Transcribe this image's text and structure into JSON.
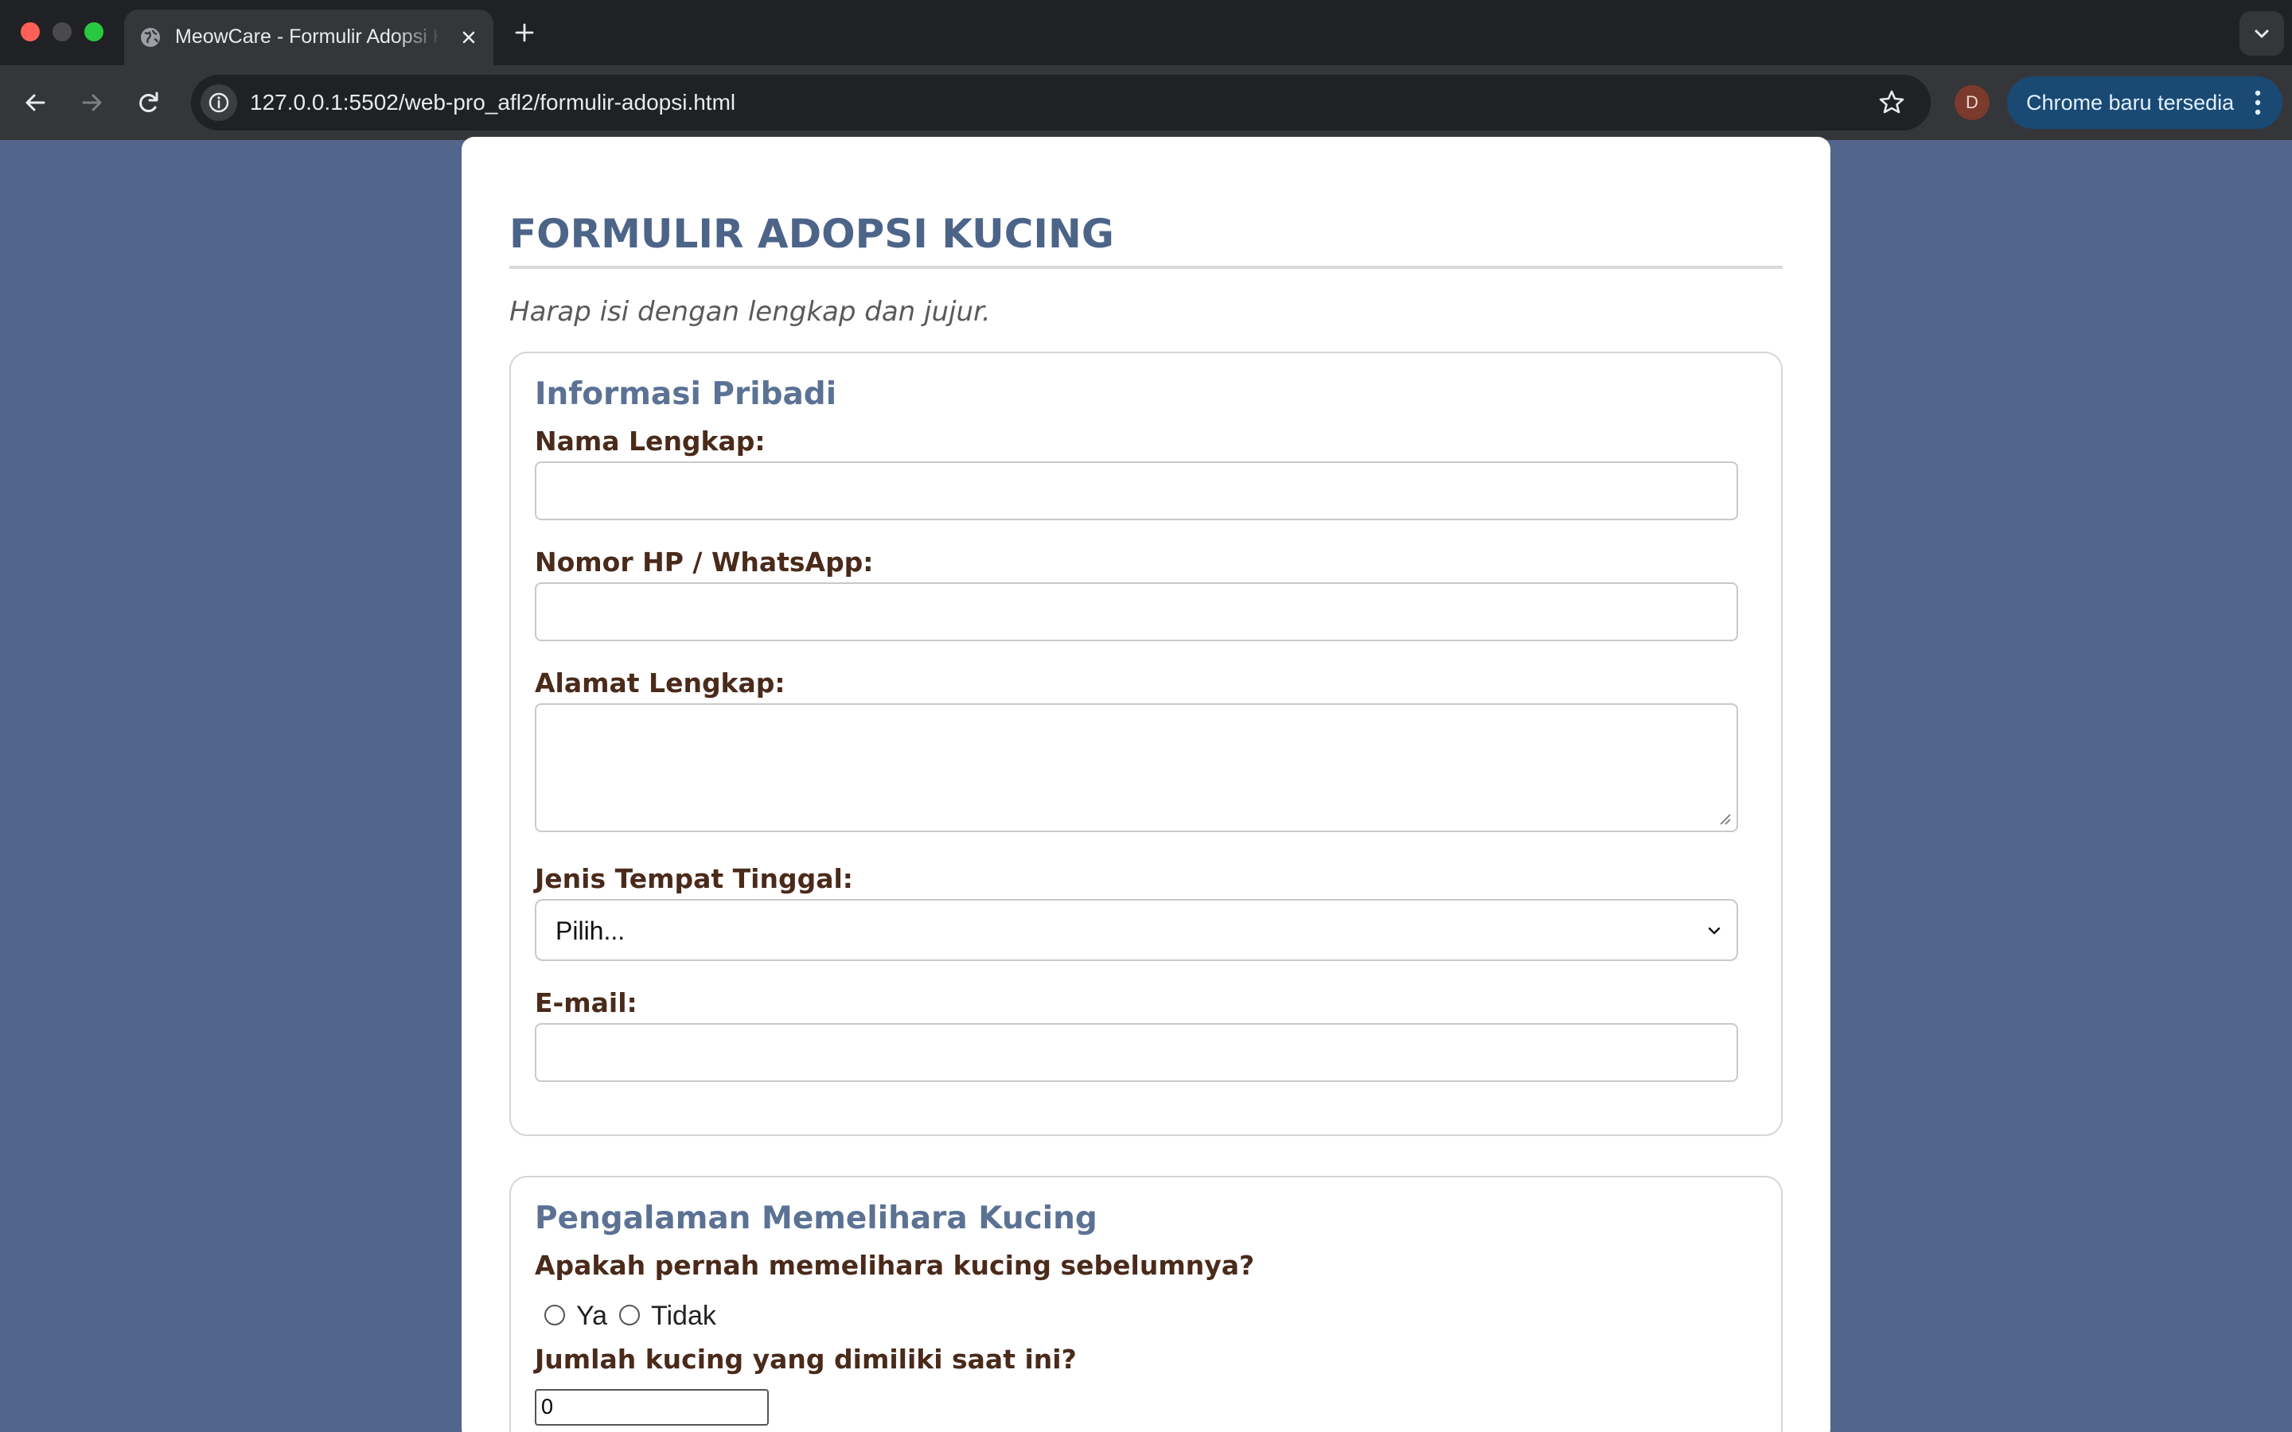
{
  "browser": {
    "tab_title": "MeowCare - Formulir Adopsi Kucing",
    "url": "127.0.0.1:5502/web-pro_afl2/formulir-adopsi.html",
    "profile_initial": "D",
    "update_label": "Chrome baru tersedia",
    "colors": {
      "chrome_bg": "#202124",
      "toolbar_bg": "#35363a",
      "update_chip": "#1a4a73"
    }
  },
  "page": {
    "title": "FORMULIR ADOPSI KUCING",
    "subtitle": "Harap isi dengan lengkap dan jujur.",
    "colors": {
      "background": "#52658a",
      "title": "#4d6489",
      "legend": "#5b7294",
      "label": "#4a2a1a"
    }
  },
  "personal": {
    "legend": "Informasi Pribadi",
    "name_label": "Nama Lengkap:",
    "name_value": "",
    "phone_label": "Nomor HP / WhatsApp:",
    "phone_value": "",
    "address_label": "Alamat Lengkap:",
    "address_value": "",
    "residence_label": "Jenis Tempat Tinggal:",
    "residence_selected": "Pilih...",
    "email_label": "E-mail:",
    "email_value": ""
  },
  "experience": {
    "legend": "Pengalaman Memelihara Kucing",
    "question_owned": "Apakah pernah memelihara kucing sebelumnya?",
    "option_yes": "Ya",
    "option_no": "Tidak",
    "question_count": "Jumlah kucing yang dimiliki saat ini?",
    "count_value": "0"
  }
}
